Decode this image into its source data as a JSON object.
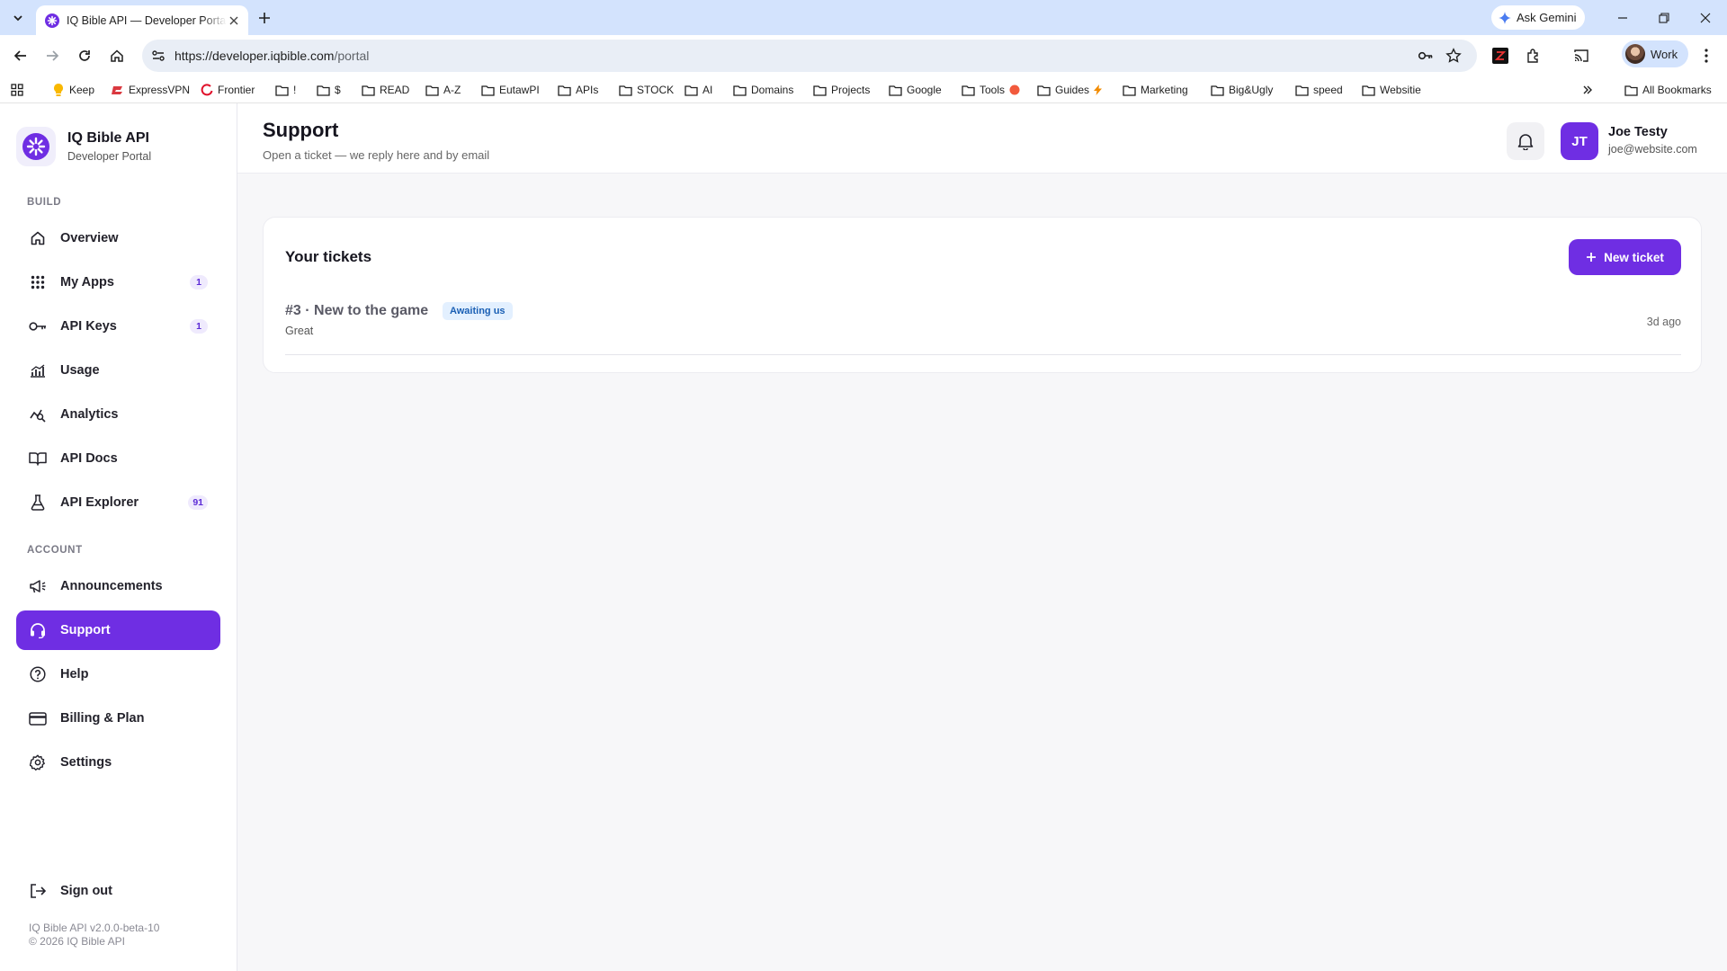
{
  "browser": {
    "tab_title": "IQ Bible API — Developer Portal",
    "gemini_label": "Ask Gemini",
    "url_host": "https://developer.iqbible.com",
    "url_path": "/portal",
    "profile_label": "Work",
    "bookmarks": [
      "Keep",
      "ExpressVPN",
      "Frontier",
      "!",
      "$",
      "READ",
      "A-Z",
      "EutawPI",
      "APIs",
      "STOCK",
      "AI",
      "Domains",
      "Projects",
      "Google",
      "Tools",
      "Guides",
      "Marketing",
      "Big&Ugly",
      "speed",
      "Websitie"
    ],
    "all_bookmarks_label": "All Bookmarks"
  },
  "brand": {
    "name": "IQ Bible API",
    "subtitle": "Developer Portal",
    "color": "#6f2ee3"
  },
  "nav": {
    "build_label": "BUILD",
    "account_label": "ACCOUNT",
    "build_items": [
      {
        "label": "Overview",
        "icon": "home-icon"
      },
      {
        "label": "My Apps",
        "icon": "grid-icon",
        "badge": "1"
      },
      {
        "label": "API Keys",
        "icon": "key-icon",
        "badge": "1"
      },
      {
        "label": "Usage",
        "icon": "bar-chart-icon"
      },
      {
        "label": "Analytics",
        "icon": "analytics-icon"
      },
      {
        "label": "API Docs",
        "icon": "book-icon"
      },
      {
        "label": "API Explorer",
        "icon": "flask-icon",
        "badge": "91"
      }
    ],
    "account_items": [
      {
        "label": "Announcements",
        "icon": "megaphone-icon"
      },
      {
        "label": "Support",
        "icon": "headset-icon",
        "active": true
      },
      {
        "label": "Help",
        "icon": "help-icon"
      },
      {
        "label": "Billing & Plan",
        "icon": "credit-card-icon"
      },
      {
        "label": "Settings",
        "icon": "gear-icon"
      }
    ],
    "sign_out": "Sign out",
    "version": "IQ Bible API v2.0.0-beta-10",
    "copyright": "© 2026 IQ Bible API"
  },
  "header": {
    "title": "Support",
    "subtitle": "Open a ticket — we reply here and by email",
    "user_initials": "JT",
    "user_name": "Joe Testy",
    "user_email": "joe@website.com"
  },
  "tickets": {
    "heading": "Your tickets",
    "new_button": "New ticket",
    "items": [
      {
        "title": "#3 · New to the game",
        "status": "Awaiting us",
        "preview": "Great",
        "time": "3d ago"
      }
    ]
  }
}
